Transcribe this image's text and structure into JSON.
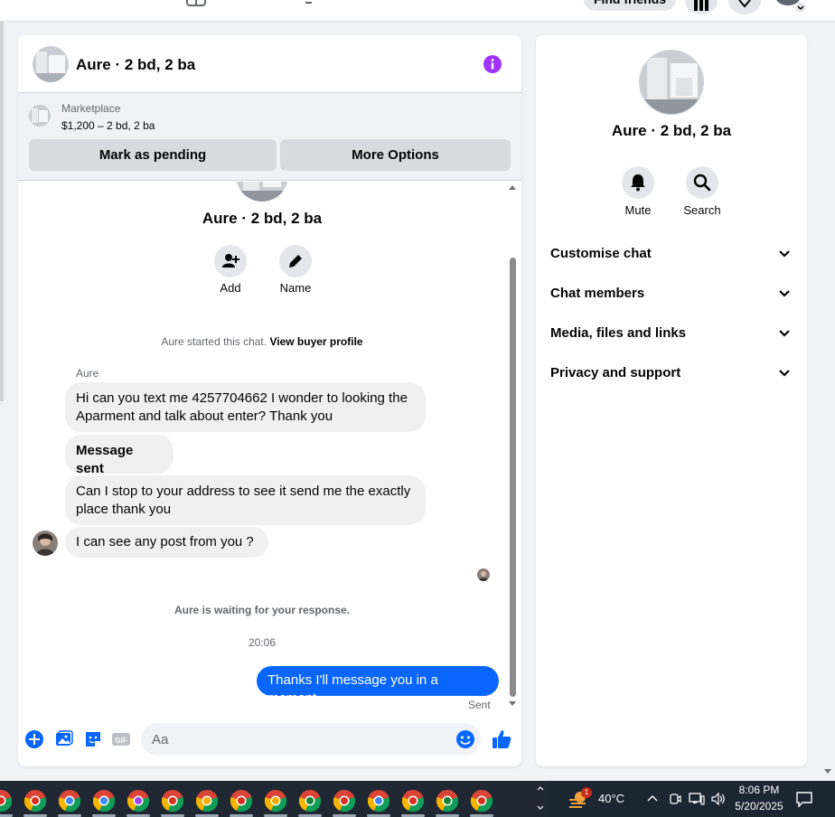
{
  "topbar": {
    "find_friends_label": "Find friends"
  },
  "chat": {
    "header_title": "Aure · 2 bd, 2 ba",
    "marketplace": {
      "label": "Marketplace",
      "price_line": "$1,200 – 2 bd, 2 ba",
      "mark_pending_label": "Mark as pending",
      "more_options_label": "More Options"
    },
    "profile": {
      "name": "Aure · 2 bd, 2 ba",
      "actions": [
        {
          "label": "Add",
          "icon": "add-person-icon"
        },
        {
          "label": "Name",
          "icon": "pencil-icon"
        }
      ]
    },
    "started_text": "Aure started this chat.",
    "view_buyer_profile": "View buyer profile",
    "sender_name": "Aure",
    "messages": [
      {
        "text": "Hi can you text me 4257704662 I wonder to looking the Aparment and talk about enter? Thank you"
      },
      {
        "text": "Message sent"
      },
      {
        "text": "Can I stop to your address to see it send me the exactly place thank you"
      },
      {
        "text": "I can see any  post  from you ?"
      }
    ],
    "waiting_text": "Aure is waiting for your response.",
    "timestamp": "20:06",
    "outgoing_message": "Thanks I'll message you in a moment",
    "sent_label": "Sent",
    "composer_placeholder": "Aa"
  },
  "info_panel": {
    "name": "Aure · 2 bd, 2 ba",
    "actions": [
      {
        "label": "Mute",
        "icon": "bell-icon"
      },
      {
        "label": "Search",
        "icon": "search-icon"
      }
    ],
    "sections": [
      {
        "label": "Customise chat"
      },
      {
        "label": "Chat members"
      },
      {
        "label": "Media, files and links"
      },
      {
        "label": "Privacy and support"
      }
    ]
  },
  "taskbar": {
    "weather_badge": "1",
    "temperature": "40°C",
    "time": "8:06 PM",
    "date": "5/20/2025"
  },
  "colors": {
    "messenger_blue": "#0866ff",
    "info_purple": "#a033ff",
    "taskbar_bg": "#1f2733"
  }
}
